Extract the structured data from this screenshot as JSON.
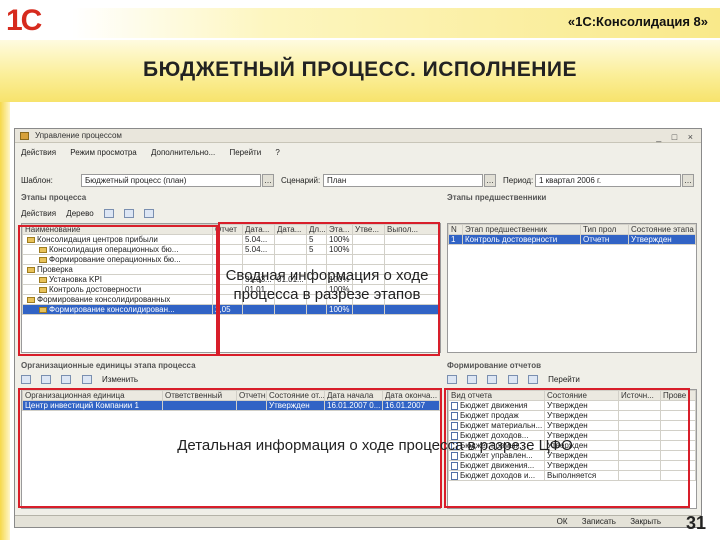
{
  "header": {
    "logo": "1С",
    "product": "«1С:Консолидация 8»"
  },
  "slide": {
    "title": "БЮДЖЕТНЫЙ ПРОЦЕСС. ИСПОЛНЕНИЕ",
    "page": "31"
  },
  "window": {
    "title": "Управление процессом",
    "menu": [
      "Действия",
      "Режим просмотра",
      "Дополнительно...",
      "Перейти"
    ],
    "template_label": "Шаблон:",
    "template_value": "Бюджетный процесс (план)",
    "scenario_label": "Сценарий:",
    "scenario_value": "План",
    "period_label": "Период:",
    "period_value": "1 квартал 2006 г."
  },
  "stages": {
    "section": "Этапы процесса",
    "toolbar": [
      "Действия",
      "Дерево"
    ],
    "columns": [
      "Наименование",
      "Отчет",
      "Дата...",
      "Дата...",
      "Дл...",
      "Эта...",
      "Утве...",
      "Выпол..."
    ],
    "rows": [
      {
        "name": "Консолидация центров прибыли",
        "c1": "",
        "c2": "5.04...",
        "c3": "",
        "c4": "5",
        "c5": "100%"
      },
      {
        "name": "Консолидация операционных бю...",
        "c1": "",
        "c2": "5.04...",
        "c3": "",
        "c4": "5",
        "c5": "100%"
      },
      {
        "name": "Формирование операционных бю...",
        "c1": "",
        "c2": "",
        "c3": "",
        "c4": "",
        "c5": ""
      },
      {
        "name": "Проверка",
        "c1": "",
        "c2": "",
        "c3": "",
        "c4": "",
        "c5": ""
      },
      {
        "name": "Установка KPI",
        "c1": "",
        "c2": "31.03...",
        "c3": "01.01...",
        "c4": "",
        "c5": "100%"
      },
      {
        "name": "Контроль достоверности",
        "c1": "",
        "c2": "01.01...",
        "c3": "",
        "c4": "",
        "c5": "100%"
      },
      {
        "name": "Формирование консолидированных",
        "c1": "",
        "c2": "",
        "c3": "",
        "c4": "",
        "c5": ""
      },
      {
        "name": "Формирование консолидирован...",
        "c1": "2,05",
        "c2": "",
        "c3": "",
        "c4": "",
        "c5": "100%"
      }
    ]
  },
  "stage_approvers": {
    "section": "Этапы предшественники",
    "columns": [
      "N",
      "Этап предшественник",
      "Тип прол",
      "Состояние этапа"
    ],
    "rows": [
      {
        "n": "1",
        "stage": "Контроль достоверности",
        "type": "Отчетн",
        "state": "Утвержден"
      }
    ]
  },
  "org_units": {
    "section": "Организационные единицы этапа процесса",
    "toolbar": [
      "Изменить"
    ],
    "columns": [
      "Организационная единица",
      "Ответственный",
      "Отчетные",
      "Состояние от...",
      "Дата начала",
      "Дата оконча..."
    ],
    "rows": [
      {
        "unit": "Центр инвестиций Компании 1",
        "resp": "",
        "state": "Утвержден",
        "start": "16.01.2007 0...",
        "end": "16.01.2007"
      }
    ]
  },
  "reports": {
    "section": "Формирование отчетов",
    "toolbar": [
      "Перейти"
    ],
    "columns": [
      "Вид отчета",
      "Состояние",
      "Источн...",
      "Прове"
    ],
    "rows": [
      {
        "type": "Бюджет движения",
        "state": "Утвержден"
      },
      {
        "type": "Бюджет продаж",
        "state": "Утвержден"
      },
      {
        "type": "Бюджет материальн...",
        "state": "Утвержден"
      },
      {
        "type": "Бюджет доходов...",
        "state": "Утвержден"
      },
      {
        "type": "Бюджет прямых...",
        "state": "Утвержден"
      },
      {
        "type": "Бюджет управлен...",
        "state": "Утвержден"
      },
      {
        "type": "Бюджет движения...",
        "state": "Утвержден"
      },
      {
        "type": "Бюджет доходов и...",
        "state": "Выполняется"
      }
    ]
  },
  "buttons": {
    "ok": "ОК",
    "save": "Записать",
    "close": "Закрыть"
  },
  "callouts": {
    "summary": "Сводная информация о ходе процесса в разрезе этапов",
    "detail": "Детальная информация о ходе процесса в разрезе ЦФО"
  },
  "colors": {
    "accent_red": "#d81e2a",
    "selection": "#3163c5",
    "band": "#f7e36c"
  }
}
